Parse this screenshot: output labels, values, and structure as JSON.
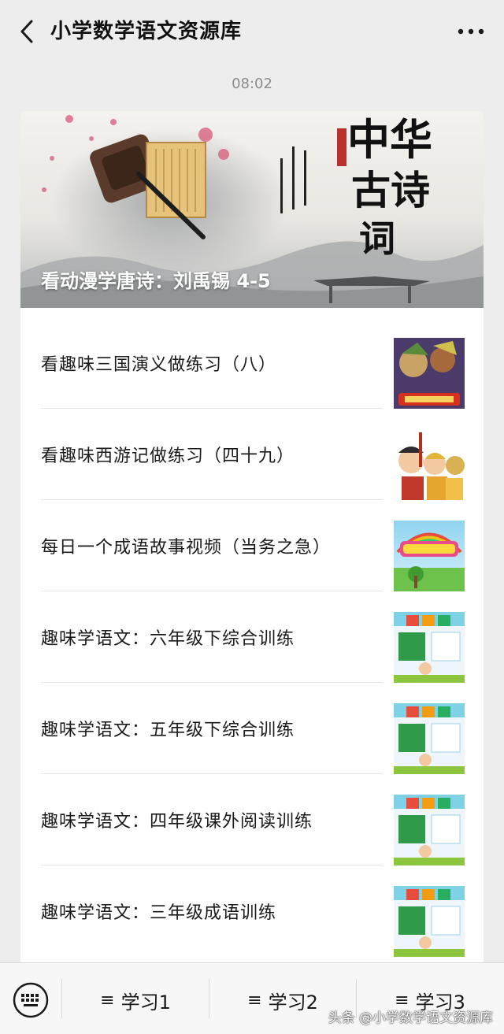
{
  "header": {
    "title": "小学数学语文资源库",
    "back_icon": "chevron-left-icon",
    "more_icon": "more-dots-icon"
  },
  "timestamp": "08:02",
  "banner": {
    "title": "看动漫学唐诗：刘禹锡 4-5",
    "image_alt": "中华古诗词"
  },
  "articles": [
    {
      "title": "看趣味三国演义做练习（八）",
      "thumb": "sanguo"
    },
    {
      "title": "看趣味西游记做练习（四十九）",
      "thumb": "xiyou"
    },
    {
      "title": "每日一个成语故事视频（当务之急）",
      "thumb": "chengyu"
    },
    {
      "title": "趣味学语文：六年级下综合训练",
      "thumb": "yuwen"
    },
    {
      "title": "趣味学语文：五年级下综合训练",
      "thumb": "yuwen"
    },
    {
      "title": "趣味学语文：四年级课外阅读训练",
      "thumb": "yuwen"
    },
    {
      "title": "趣味学语文：三年级成语训练",
      "thumb": "yuwen"
    }
  ],
  "bottom_menu": {
    "keyboard_icon": "keyboard-icon",
    "items": [
      {
        "label": "学习1",
        "icon": "menu-lines-icon"
      },
      {
        "label": "学习2",
        "icon": "menu-lines-icon"
      },
      {
        "label": "学习3",
        "icon": "menu-lines-icon"
      }
    ]
  },
  "watermark": "头条 @小学数学语文资源库",
  "colors": {
    "background": "#ededed",
    "card": "#ffffff",
    "text": "#1a1a1a",
    "muted": "#8c8c8c"
  }
}
